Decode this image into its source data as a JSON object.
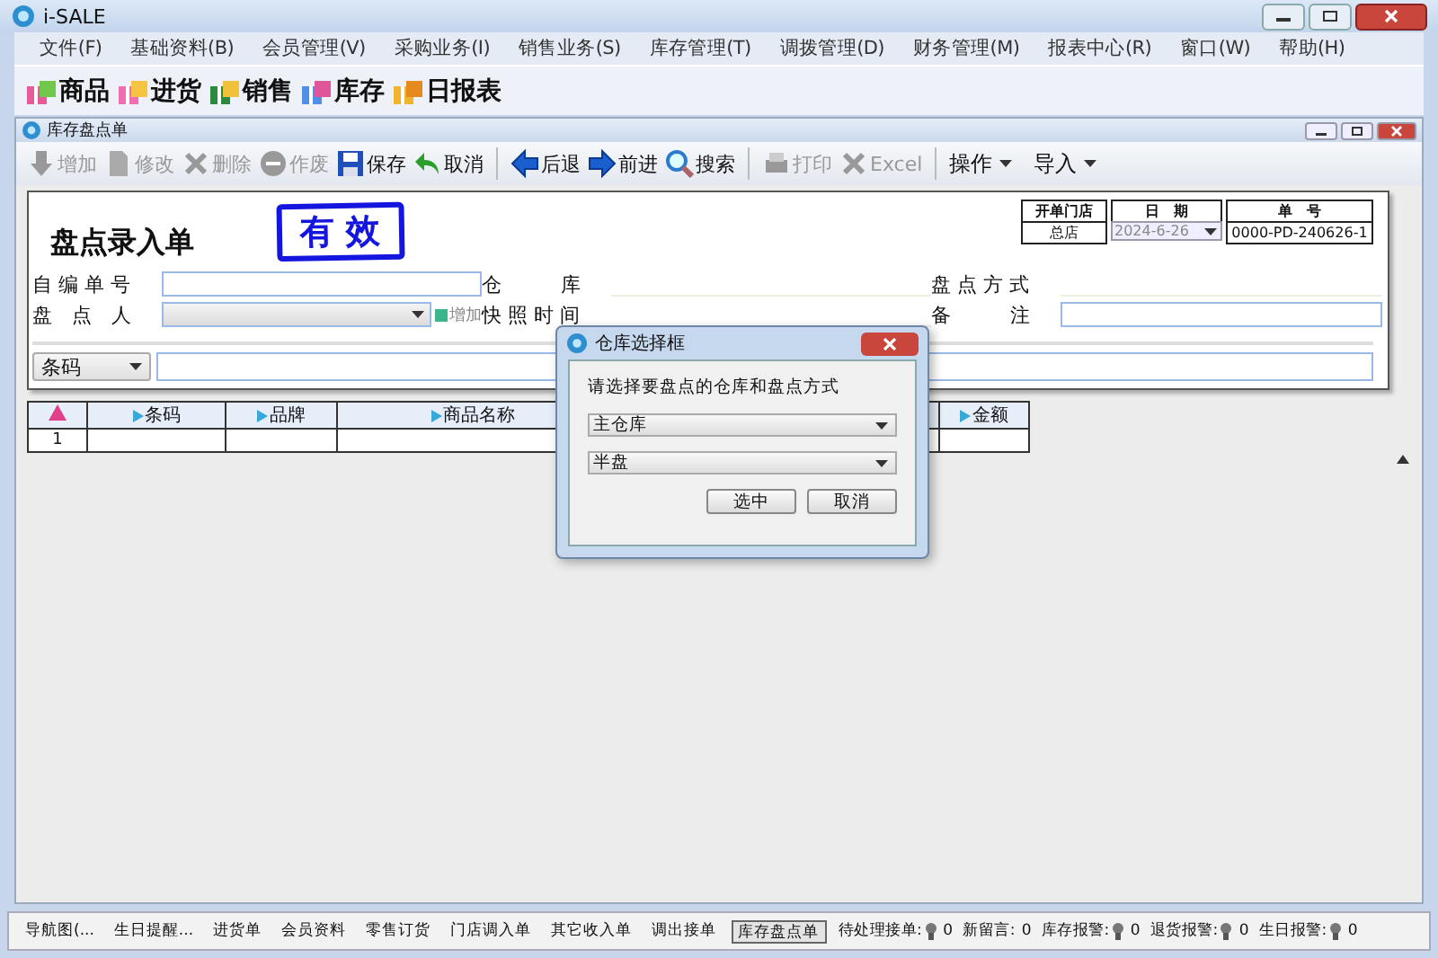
{
  "window": {
    "title": "i-SALE"
  },
  "menu": [
    "文件(F)",
    "基础资料(B)",
    "会员管理(V)",
    "采购业务(I)",
    "销售业务(S)",
    "库存管理(T)",
    "调拨管理(D)",
    "财务管理(M)",
    "报表中心(R)",
    "窗口(W)",
    "帮助(H)"
  ],
  "quick_toolbar": [
    "商品",
    "进货",
    "销售",
    "库存",
    "日报表"
  ],
  "child_window": {
    "title": "库存盘点单"
  },
  "toolbar": [
    {
      "label": "增加",
      "kind": "button",
      "disabled": true
    },
    {
      "label": "修改",
      "kind": "button",
      "disabled": true
    },
    {
      "label": "删除",
      "kind": "button",
      "disabled": true
    },
    {
      "label": "作废",
      "kind": "button",
      "disabled": true
    },
    {
      "label": "保存",
      "kind": "button",
      "disabled": false
    },
    {
      "label": "取消",
      "kind": "button",
      "disabled": false
    },
    {
      "label": "后退",
      "kind": "button",
      "disabled": false
    },
    {
      "label": "前进",
      "kind": "button",
      "disabled": false
    },
    {
      "label": "搜索",
      "kind": "button",
      "disabled": false
    },
    {
      "label": "打印",
      "kind": "button",
      "disabled": true
    },
    {
      "label": "Excel",
      "kind": "button",
      "disabled": true
    },
    {
      "label": "操作",
      "kind": "menu",
      "disabled": false
    },
    {
      "label": "导入",
      "kind": "menu",
      "disabled": false
    }
  ],
  "form": {
    "title": "盘点录入单",
    "stamp": "有 效",
    "header_table": [
      {
        "label": "开单门店",
        "value": "总店"
      },
      {
        "label": "日　期",
        "value": "2024-6-26"
      },
      {
        "label": "单　号",
        "value": "0000-PD-240626-1"
      }
    ],
    "fields": [
      {
        "label": "自 编 单 号",
        "kind": "input"
      },
      {
        "label": "仓　　　库",
        "kind": "line"
      },
      {
        "label": "盘 点 方 式",
        "kind": "line"
      },
      {
        "label": "盘　点　人",
        "kind": "select",
        "add": "增加"
      },
      {
        "label": "快 照 时 间",
        "kind": "line"
      },
      {
        "label": "备　　　注",
        "kind": "input"
      }
    ],
    "search_mode": "条码"
  },
  "grid": {
    "columns": [
      "条码",
      "品牌",
      "商品名称",
      "金额"
    ],
    "rows": [
      {
        "index": "1"
      }
    ]
  },
  "dialog": {
    "title": "仓库选择框",
    "prompt": "请选择要盘点的仓库和盘点方式",
    "warehouse": "主仓库",
    "mode": "半盘",
    "buttons": [
      "选中",
      "取消"
    ]
  },
  "taskbar": [
    {
      "label": "导航图(...",
      "selected": false
    },
    {
      "label": "生日提醒...",
      "selected": false
    },
    {
      "label": "进货单",
      "selected": false
    },
    {
      "label": "会员资料",
      "selected": false
    },
    {
      "label": "零售订货",
      "selected": false
    },
    {
      "label": "门店调入单",
      "selected": false
    },
    {
      "label": "其它收入单",
      "selected": false
    },
    {
      "label": "调出接单",
      "selected": false
    },
    {
      "label": "库存盘点单",
      "selected": true
    }
  ],
  "alerts": [
    {
      "label": "待处理接单:",
      "count": "0",
      "bulb": true
    },
    {
      "label": "新留言:",
      "count": "0",
      "bulb": false
    },
    {
      "label": "库存报警:",
      "count": "0",
      "bulb": true
    },
    {
      "label": "退货报警:",
      "count": "0",
      "bulb": true
    },
    {
      "label": "生日报警:",
      "count": "0",
      "bulb": true
    }
  ]
}
